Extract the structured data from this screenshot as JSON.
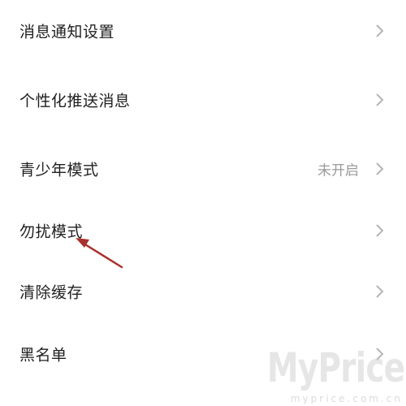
{
  "settings": {
    "items": [
      {
        "label": "消息通知设置",
        "value": ""
      },
      {
        "label": "个性化推送消息",
        "value": ""
      },
      {
        "label": "青少年模式",
        "value": "未开启"
      },
      {
        "label": "勿扰模式",
        "value": ""
      },
      {
        "label": "清除缓存",
        "value": ""
      },
      {
        "label": "黑名单",
        "value": ""
      }
    ]
  },
  "icons": {
    "row_chevron": "chevron-right-icon",
    "annotation": "arrow-icon"
  },
  "colors": {
    "text_primary": "#1f1f1f",
    "text_secondary": "#9a9a9a",
    "chevron": "#b5b5b5",
    "annotation_arrow": "#a8322d",
    "background": "#ffffff"
  },
  "watermark": {
    "brand": "MyPrice",
    "url": "myprice.com.cn"
  }
}
